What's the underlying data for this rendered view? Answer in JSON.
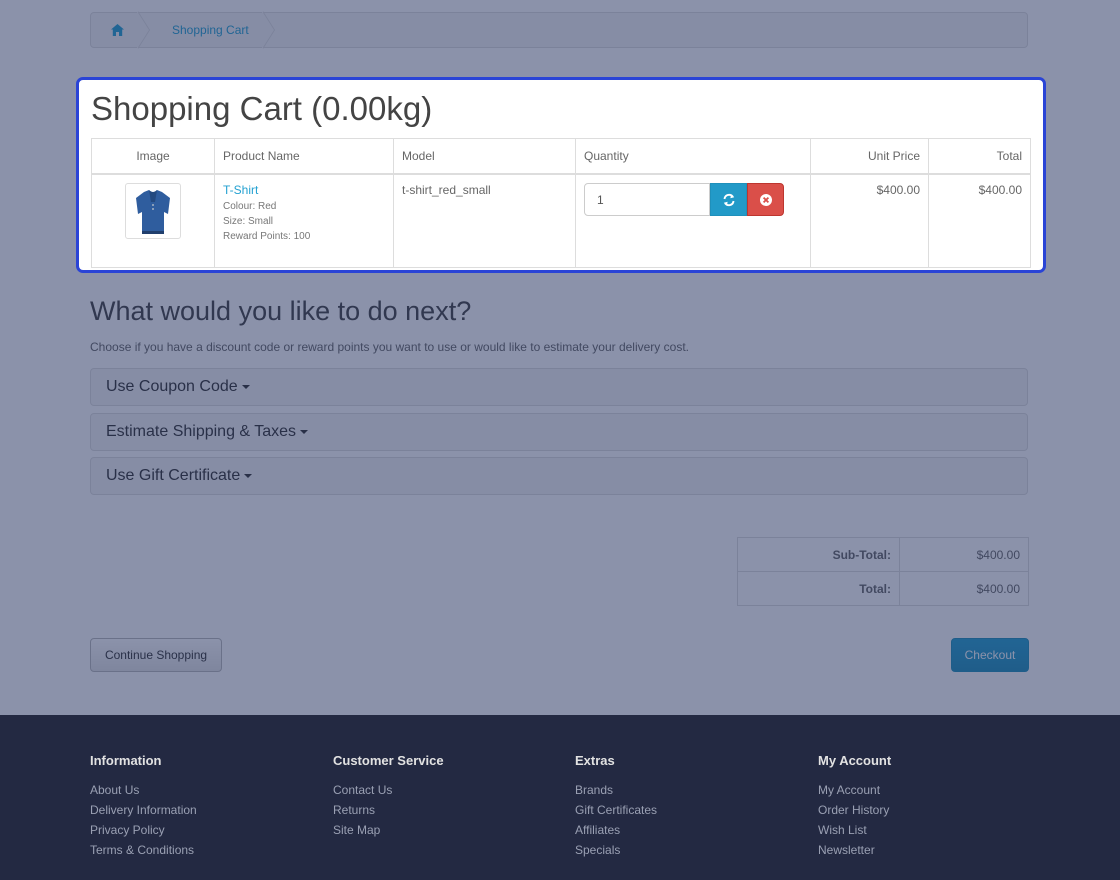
{
  "breadcrumb": {
    "home_icon": "home-icon",
    "items": [
      "Shopping Cart"
    ]
  },
  "cart": {
    "title": "Shopping Cart  (0.00kg)",
    "columns": [
      "Image",
      "Product Name",
      "Model",
      "Quantity",
      "Unit Price",
      "Total"
    ],
    "items": [
      {
        "name": "T-Shirt",
        "options": [
          "Colour: Red",
          "Size: Small",
          "Reward Points: 100"
        ],
        "model": "t-shirt_red_small",
        "quantity": "1",
        "unit_price": "$400.00",
        "total": "$400.00"
      }
    ]
  },
  "next": {
    "title": "What would you like to do next?",
    "description": "Choose if you have a discount code or reward points you want to use or would like to estimate your delivery cost.",
    "panels": [
      "Use Coupon Code",
      "Estimate Shipping & Taxes",
      "Use Gift Certificate"
    ]
  },
  "totals": [
    {
      "label": "Sub-Total:",
      "value": "$400.00"
    },
    {
      "label": "Total:",
      "value": "$400.00"
    }
  ],
  "buttons": {
    "continue": "Continue Shopping",
    "checkout": "Checkout"
  },
  "footer": {
    "columns": [
      {
        "title": "Information",
        "links": [
          "About Us",
          "Delivery Information",
          "Privacy Policy",
          "Terms & Conditions"
        ]
      },
      {
        "title": "Customer Service",
        "links": [
          "Contact Us",
          "Returns",
          "Site Map"
        ]
      },
      {
        "title": "Extras",
        "links": [
          "Brands",
          "Gift Certificates",
          "Affiliates",
          "Specials"
        ]
      },
      {
        "title": "My Account",
        "links": [
          "My Account",
          "Order History",
          "Wish List",
          "Newsletter"
        ]
      }
    ]
  },
  "colors": {
    "link": "#23a1d1",
    "highlight_border": "#2a44d6",
    "overlay": "#202e5c",
    "footer_bg": "#232942",
    "refresh_button": "#229ac8",
    "remove_button": "#da4f49"
  }
}
